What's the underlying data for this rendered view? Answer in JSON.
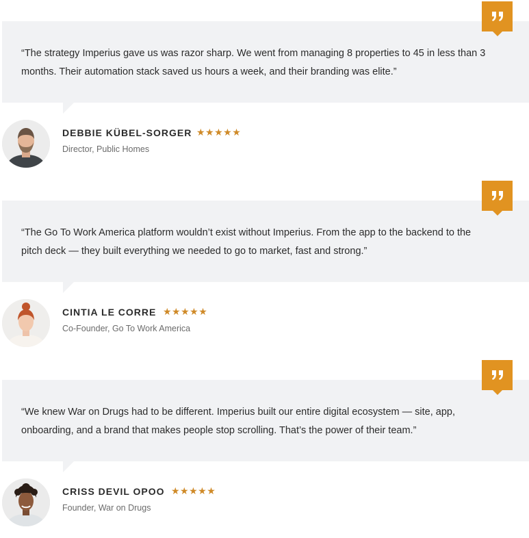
{
  "colors": {
    "accent": "#e19321",
    "star": "#cf8a28",
    "quote_background": "#f1f2f4"
  },
  "testimonials": [
    {
      "quote": "“The strategy Imperius gave us was razor sharp. We went from managing 8 properties to 45 in less than 3 months. Their automation stack saved us hours a week, and their branding was elite.”",
      "name": "DEBBIE KÜBEL-SORGER",
      "stars": "★★★★★",
      "rating": 5,
      "role": "Director, Public Homes",
      "avatar_icon": "man-with-beard-portrait"
    },
    {
      "quote": "“The Go To Work America platform wouldn’t exist without Imperius. From the app to the backend to the pitch deck — they built everything we needed to go to market, fast and strong.”",
      "name": "CINTIA LE CORRE",
      "stars": "★★★★★",
      "rating": 5,
      "role": "Co-Founder, Go To Work America",
      "avatar_icon": "woman-with-red-hair-portrait"
    },
    {
      "quote": "“We knew War on Drugs had to be different. Imperius built our entire digital ecosystem — site, app, onboarding, and a brand that makes people stop scrolling. That’s the power of their team.”",
      "name": "CRISS DEVIL OPOO",
      "stars": "★★★★★",
      "rating": 5,
      "role": "Founder, War on Drugs",
      "avatar_icon": "man-with-curly-hair-portrait"
    }
  ]
}
